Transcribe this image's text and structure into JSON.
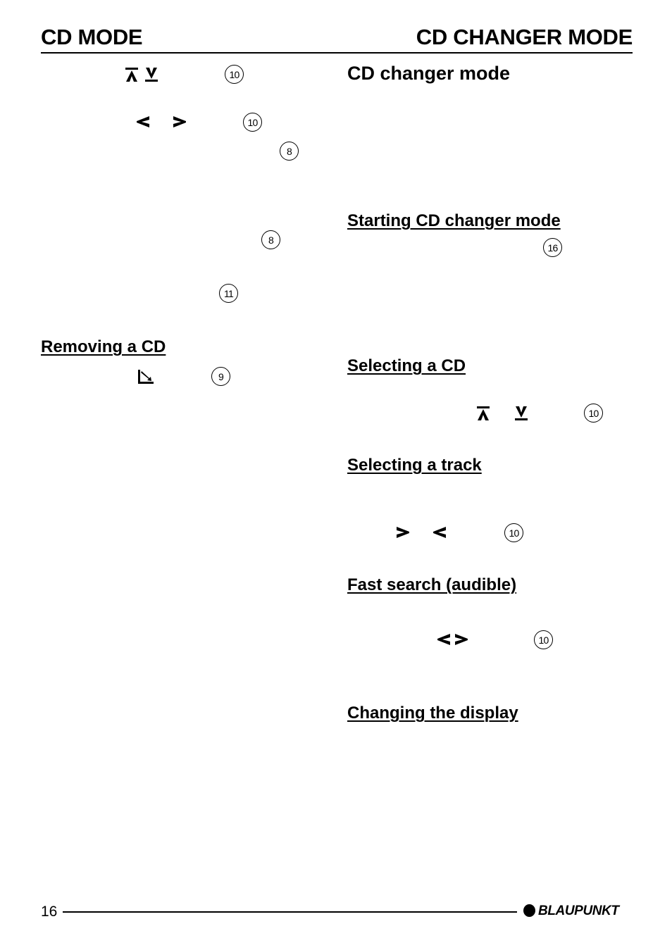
{
  "header": {
    "left_title": "CD MODE",
    "right_title": "CD CHANGER MODE"
  },
  "left_column": {
    "refs": {
      "cd_up_down_button": "10",
      "track_prev_next_button": "10",
      "ref_a": "8",
      "ref_b": "8",
      "ref_c": "11",
      "eject_button": "9"
    },
    "sections": [
      {
        "heading": "Removing a CD"
      }
    ],
    "symbols": [
      "arrow-up-bar",
      "arrow-down-bar",
      "chevron-left",
      "chevron-right",
      "eject"
    ]
  },
  "right_column": {
    "title": "CD changer mode",
    "sections": [
      {
        "heading": "Starting CD changer mode",
        "ref": "16"
      },
      {
        "heading": "Selecting a CD",
        "ref": "10",
        "symbols": [
          "arrow-up-bar",
          "arrow-down-bar"
        ]
      },
      {
        "heading": "Selecting a track",
        "ref": "10",
        "symbols": [
          "chevron-right",
          "chevron-left"
        ]
      },
      {
        "heading": "Fast search (audible)",
        "ref": "10",
        "symbols": [
          "chevron-left",
          "chevron-right"
        ]
      },
      {
        "heading": "Changing the display"
      }
    ]
  },
  "footer": {
    "page_number": "16",
    "brand": "BLAUPUNKT"
  }
}
